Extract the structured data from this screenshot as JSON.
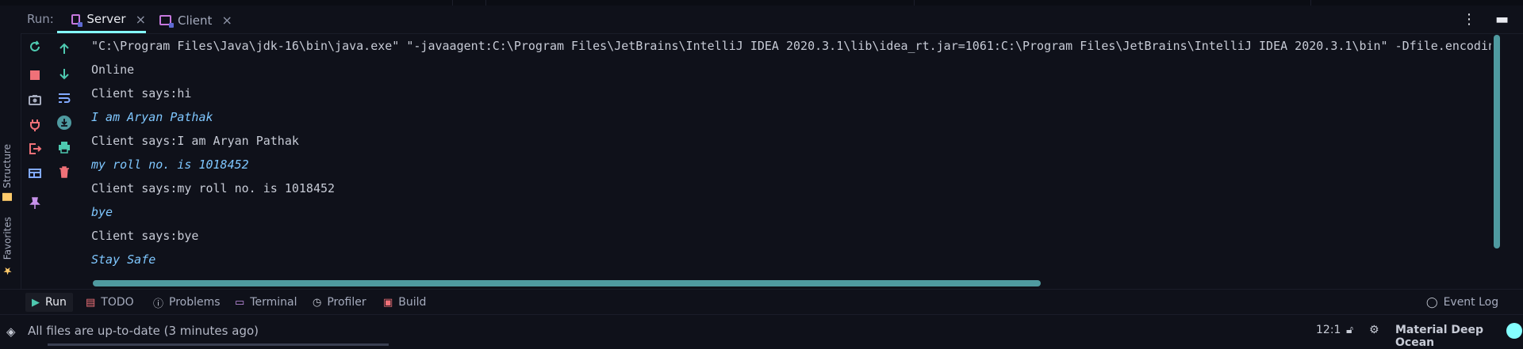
{
  "run_bar": {
    "label": "Run:",
    "tabs": [
      {
        "label": "Server",
        "active": true
      },
      {
        "label": "Client",
        "active": false
      }
    ],
    "close_glyph": "×"
  },
  "side_panels": {
    "structure_label": "Structure",
    "favorites_label": "Favorites"
  },
  "console": {
    "lines": [
      {
        "text": "\"C:\\Program Files\\Java\\jdk-16\\bin\\java.exe\" \"-javaagent:C:\\Program Files\\JetBrains\\IntelliJ IDEA 2020.3.1\\lib\\idea_rt.jar=1061:C:\\Program Files\\JetBrains\\IntelliJ IDEA 2020.3.1\\bin\" -Dfile.encoding",
        "kind": "output"
      },
      {
        "text": "Online",
        "kind": "output"
      },
      {
        "text": "Client says:hi",
        "kind": "output"
      },
      {
        "text": "I am Aryan Pathak",
        "kind": "input"
      },
      {
        "text": "Client says:I am Aryan Pathak",
        "kind": "output"
      },
      {
        "text": "my roll no. is 1018452",
        "kind": "input"
      },
      {
        "text": "Client says:my roll no. is 1018452",
        "kind": "output"
      },
      {
        "text": "bye",
        "kind": "input"
      },
      {
        "text": "Client says:bye",
        "kind": "output"
      },
      {
        "text": "Stay Safe",
        "kind": "input"
      }
    ]
  },
  "tool_windows": [
    {
      "label": "Run",
      "icon": "run-icon",
      "active": true
    },
    {
      "label": "TODO",
      "icon": "todo-icon",
      "active": false
    },
    {
      "label": "Problems",
      "icon": "problems-icon",
      "active": false
    },
    {
      "label": "Terminal",
      "icon": "terminal-icon",
      "active": false
    },
    {
      "label": "Profiler",
      "icon": "profiler-icon",
      "active": false
    },
    {
      "label": "Build",
      "icon": "build-icon",
      "active": false
    }
  ],
  "event_log_label": "Event Log",
  "status": {
    "message": "All files are up-to-date (3 minutes ago)",
    "cursor_position": "12:1",
    "theme_name": "Material Deep Ocean"
  },
  "colors": {
    "background": "#0f111a",
    "accent": "#84ffff",
    "stop_red": "#f07178",
    "input_text": "#7fc7ff"
  }
}
